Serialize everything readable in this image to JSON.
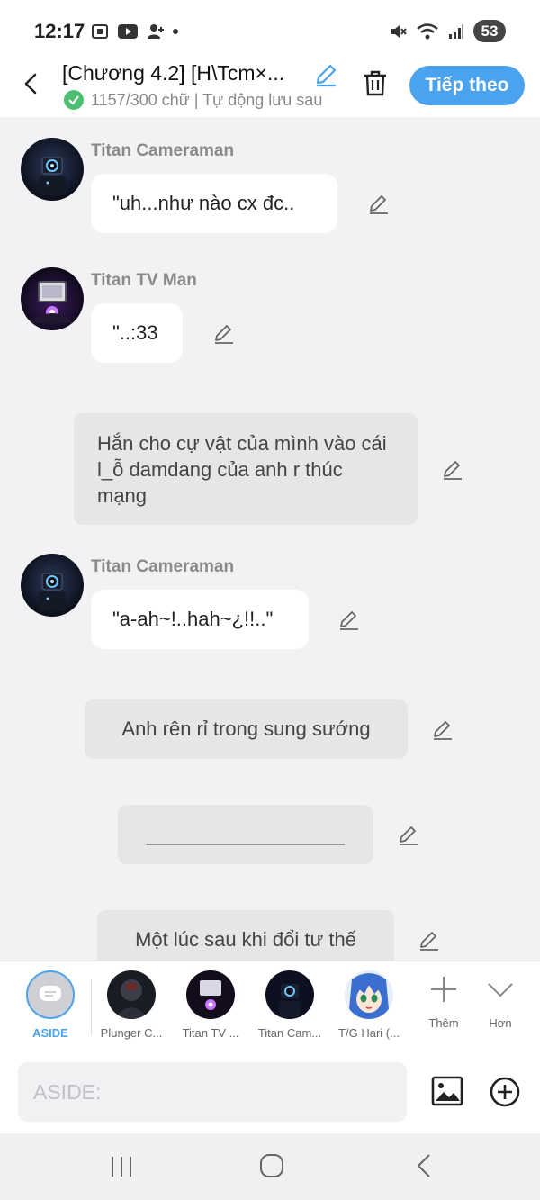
{
  "status_bar": {
    "time": "12:17",
    "battery": "53"
  },
  "header": {
    "title": "[Chương 4.2] [H\\Tcm×...",
    "subtitle": "1157/300 chữ | Tự động lưu sau",
    "next_label": "Tiếp theo"
  },
  "messages": [
    {
      "type": "character",
      "sender": "Titan Cameraman",
      "text": "\"uh...như nào cx đc.."
    },
    {
      "type": "character",
      "sender": "Titan TV Man",
      "text": "\"..:33"
    },
    {
      "type": "aside",
      "text": "Hắn cho cự vật của mình vào cái l_ỗ damdang của anh r thúc mạng"
    },
    {
      "type": "character",
      "sender": "Titan Cameraman",
      "text": "\"a-ah~!..hah~¿!!..\""
    },
    {
      "type": "aside",
      "text": "Anh rên rỉ trong sung sướng"
    },
    {
      "type": "aside",
      "text": "__________________"
    },
    {
      "type": "aside",
      "text": "Một lúc sau khi đổi tư thế"
    }
  ],
  "character_bar": {
    "items": [
      {
        "label": "ASIDE"
      },
      {
        "label": "Plunger C..."
      },
      {
        "label": "Titan TV ..."
      },
      {
        "label": "Titan Cam..."
      },
      {
        "label": "T/G Hari (..."
      }
    ],
    "add_label": "Thêm",
    "more_label": "Hơn"
  },
  "input": {
    "placeholder": "ASIDE:"
  },
  "colors": {
    "accent": "#4ba3f0",
    "check": "#4cbf73",
    "background": "#f2f2f4"
  },
  "icons": [
    "back-arrow-icon",
    "edit-pencil-icon",
    "trash-icon",
    "image-icon",
    "plus-circle-icon",
    "chevron-down-icon",
    "plus-icon"
  ]
}
